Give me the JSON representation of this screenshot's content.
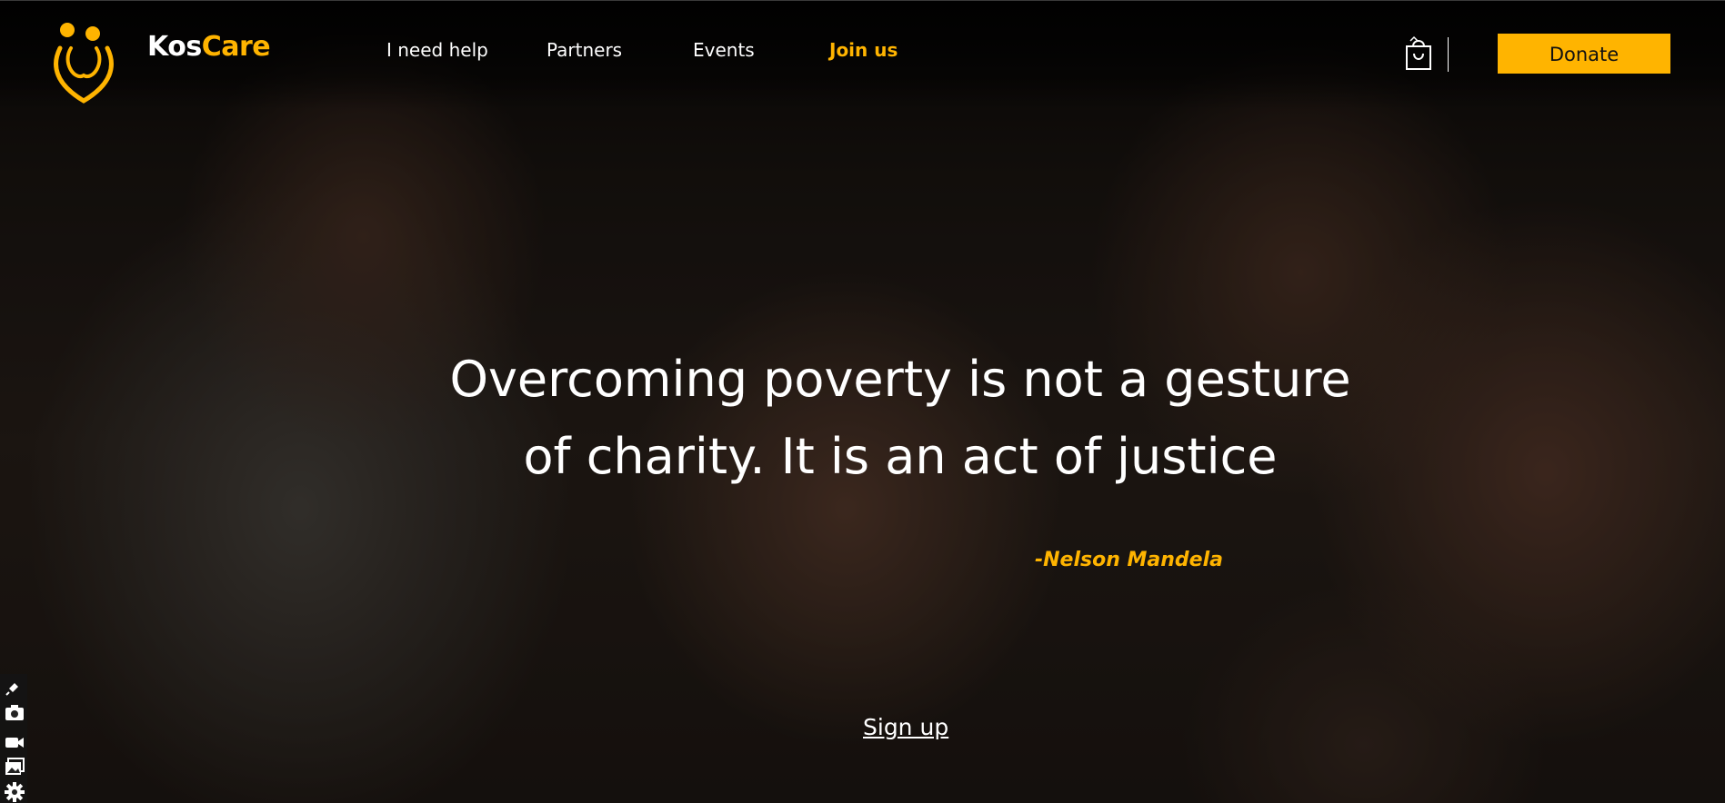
{
  "header": {
    "brand_part1": "Kos",
    "brand_part2": "Care",
    "nav": [
      {
        "label": "I need help"
      },
      {
        "label": "Partners"
      },
      {
        "label": "Events"
      },
      {
        "label": "Join us"
      }
    ],
    "cart_icon": "shopping-bag-icon",
    "donate_label": "Donate"
  },
  "hero": {
    "quote_line1": "Overcoming poverty is not a gesture",
    "quote_line2": "of charity. It is an act of justice",
    "author": "-Nelson Mandela",
    "signup_label": "Sign up"
  },
  "side_tools": [
    "pin-icon",
    "camera-icon",
    "video-icon",
    "gallery-icon",
    "settings-icon"
  ],
  "colors": {
    "accent": "#ffb400",
    "text": "#ffffff"
  }
}
